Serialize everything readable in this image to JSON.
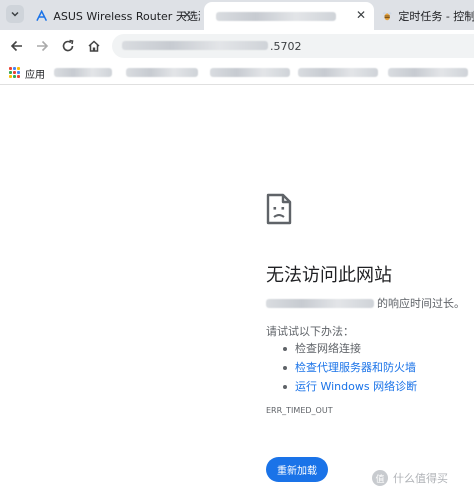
{
  "tabs": [
    {
      "title": "ASUS Wireless Router 天选游",
      "icon": "asus-logo-icon"
    },
    {
      "title": "",
      "icon": "page-icon",
      "active": true
    },
    {
      "title": "定时任务 - 控制面",
      "icon": "bee-icon"
    }
  ],
  "toolbar": {
    "url_suffix": ".5702"
  },
  "bookmarks": {
    "apps_label": "应用"
  },
  "error": {
    "heading": "无法访问此网站",
    "host_suffix": "的响应时间过长。",
    "try_label": "请试试以下办法：",
    "suggestions": [
      {
        "text": "检查网络连接",
        "link": false
      },
      {
        "text": "检查代理服务器和防火墙",
        "link": true
      },
      {
        "text": "运行 Windows 网络诊断",
        "link": true
      }
    ],
    "code": "ERR_TIMED_OUT",
    "reload_label": "重新加载"
  },
  "watermark": {
    "badge": "值",
    "text": "什么值得买"
  },
  "colors": {
    "accent": "#1a73e8",
    "tabstrip": "#dee1e6"
  }
}
